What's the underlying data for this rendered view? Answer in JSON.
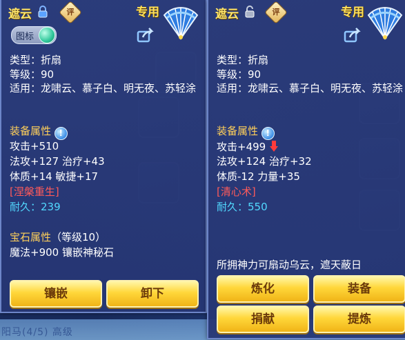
{
  "background": {
    "bottom_text": "阳马(4/5) 高级"
  },
  "left_panel": {
    "title": "遮云",
    "eval_badge": "评",
    "exclusive_label": "专用",
    "toggle_label": "图标",
    "type_line": "类型：折扇",
    "level_line": "等级：90",
    "usable_line": "适用：龙啸云、慕子白、明无夜、苏轻涂",
    "attr_header": "装备属性",
    "attr_lines": [
      "攻击+510",
      "法攻+127 治疗+43",
      "体质+14 敏捷+17"
    ],
    "special": "[涅槃重生]",
    "durability_label": "耐久：",
    "durability_value": "239",
    "gem_header": "宝石属性",
    "gem_level": "（等级10）",
    "gem_line": "魔法+900 镶嵌神秘石",
    "buttons": {
      "inlay": "镶嵌",
      "unequip": "卸下"
    }
  },
  "right_panel": {
    "title": "遮云",
    "eval_badge": "评",
    "exclusive_label": "专用",
    "type_line": "类型：折扇",
    "level_line": "等级：90",
    "usable_line": "适用：龙啸云、慕子白、明无夜、苏轻涂",
    "attr_header": "装备属性",
    "attr_lines": [
      "攻击+499",
      "法攻+124 治疗+32",
      "体质-12 力量+35"
    ],
    "special": "[清心术]",
    "durability_label": "耐久：",
    "durability_value": "550",
    "description": "所拥神力可扇动乌云，遮天蔽日",
    "buttons": {
      "refine": "炼化",
      "equip": "装备",
      "donate": "捐献",
      "extract": "提炼"
    }
  },
  "colors": {
    "gold_text": "#ffd05a",
    "special_red": "#ff5a5a",
    "durability_cyan": "#52d9ff",
    "button_gold": "#ffd73a"
  },
  "icons": [
    "lock-icon",
    "unlock-icon",
    "eval-badge-icon",
    "fan-item-icon",
    "share-icon",
    "info-icon",
    "down-arrow-icon"
  ]
}
